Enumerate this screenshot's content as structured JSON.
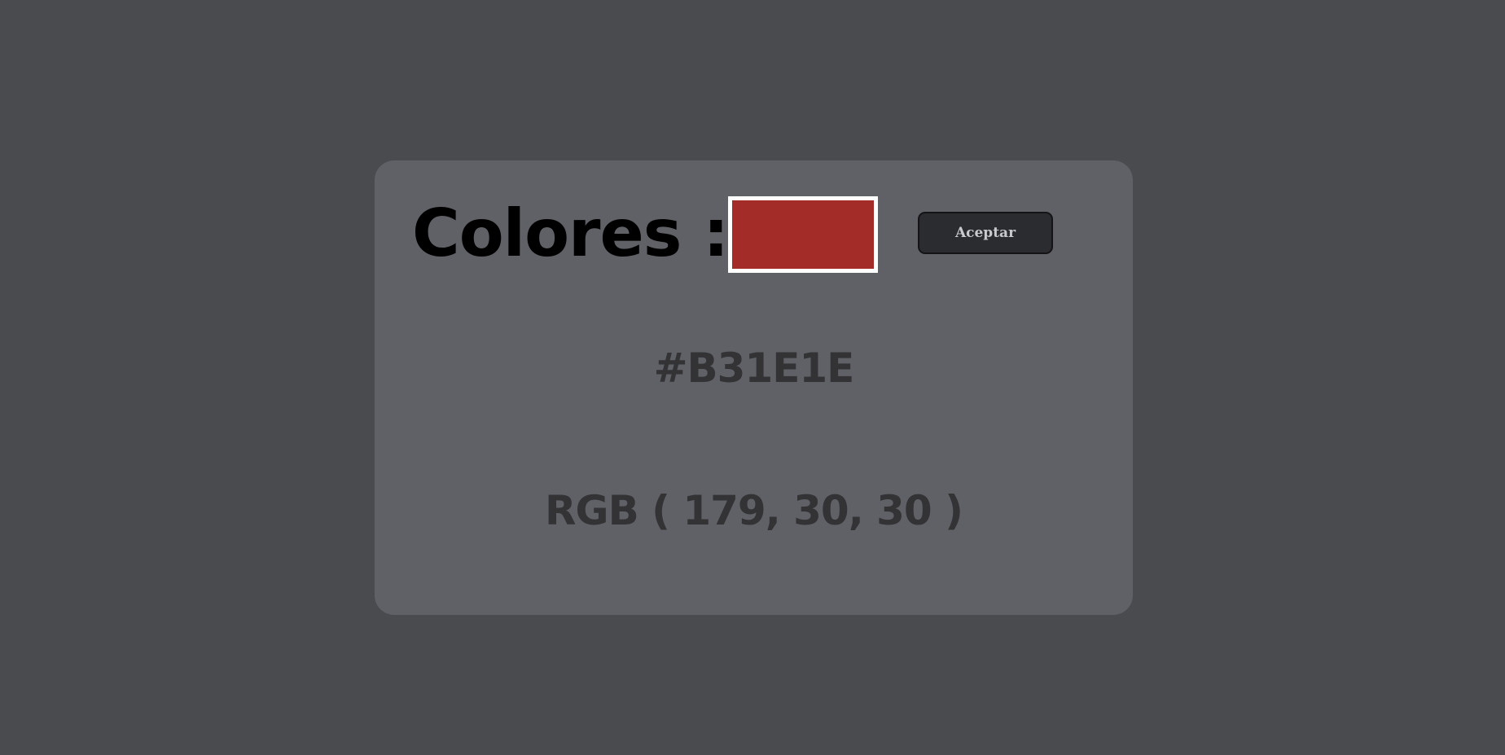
{
  "page": {
    "background_color": "#4a4b4f"
  },
  "card": {
    "background_color": "#5f6166",
    "title": "Colores :",
    "swatch": {
      "color": "#a32c29",
      "border_color": "#ffffff"
    },
    "accept_button": {
      "label": "Aceptar"
    },
    "hex_text": "#B31E1E",
    "rgb_text": "RGB ( 179, 30, 30 )"
  }
}
